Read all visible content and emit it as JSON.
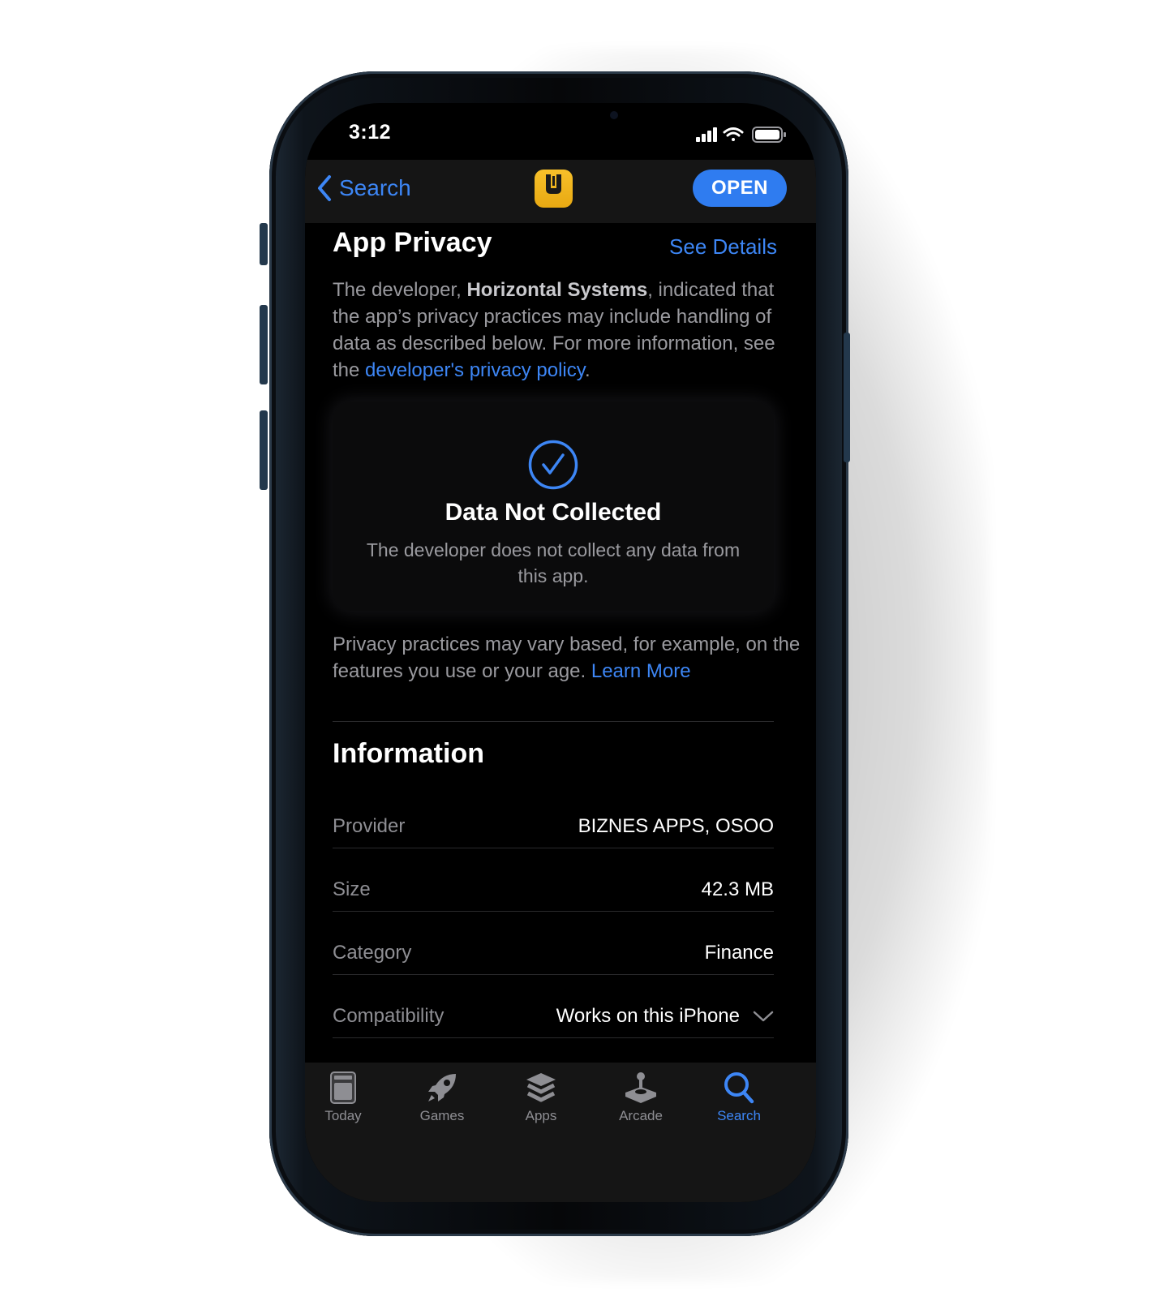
{
  "status": {
    "time": "3:12"
  },
  "nav": {
    "back_label": "Search",
    "open_label": "OPEN"
  },
  "privacy": {
    "title": "App Privacy",
    "see_details": "See Details",
    "intro_prefix": "The developer, ",
    "developer": "Horizontal Systems",
    "intro_middle": ", indicated that the app’s privacy practices may include handling of data as described below. For more information, see the ",
    "policy_link": "developer's privacy policy",
    "intro_suffix": ".",
    "card_title": "Data Not Collected",
    "card_body": "The developer does not collect any data from this app.",
    "note": "Privacy practices may vary based, for example, on the features you use or your age. ",
    "learn_more": "Learn More"
  },
  "information": {
    "title": "Information",
    "rows": [
      {
        "label": "Provider",
        "value": "BIZNES APPS, OSOO"
      },
      {
        "label": "Size",
        "value": "42.3 MB"
      },
      {
        "label": "Category",
        "value": "Finance"
      },
      {
        "label": "Compatibility",
        "value": "Works on this iPhone"
      }
    ]
  },
  "tabs": [
    {
      "label": "Today",
      "icon": "today-icon"
    },
    {
      "label": "Games",
      "icon": "rocket-icon"
    },
    {
      "label": "Apps",
      "icon": "layers-icon"
    },
    {
      "label": "Arcade",
      "icon": "joystick-icon"
    },
    {
      "label": "Search",
      "icon": "search-icon",
      "active": true
    }
  ],
  "colors": {
    "accent": "#3d86f5",
    "background": "#000000",
    "bar": "#151515",
    "app_icon": "#f2b820"
  }
}
